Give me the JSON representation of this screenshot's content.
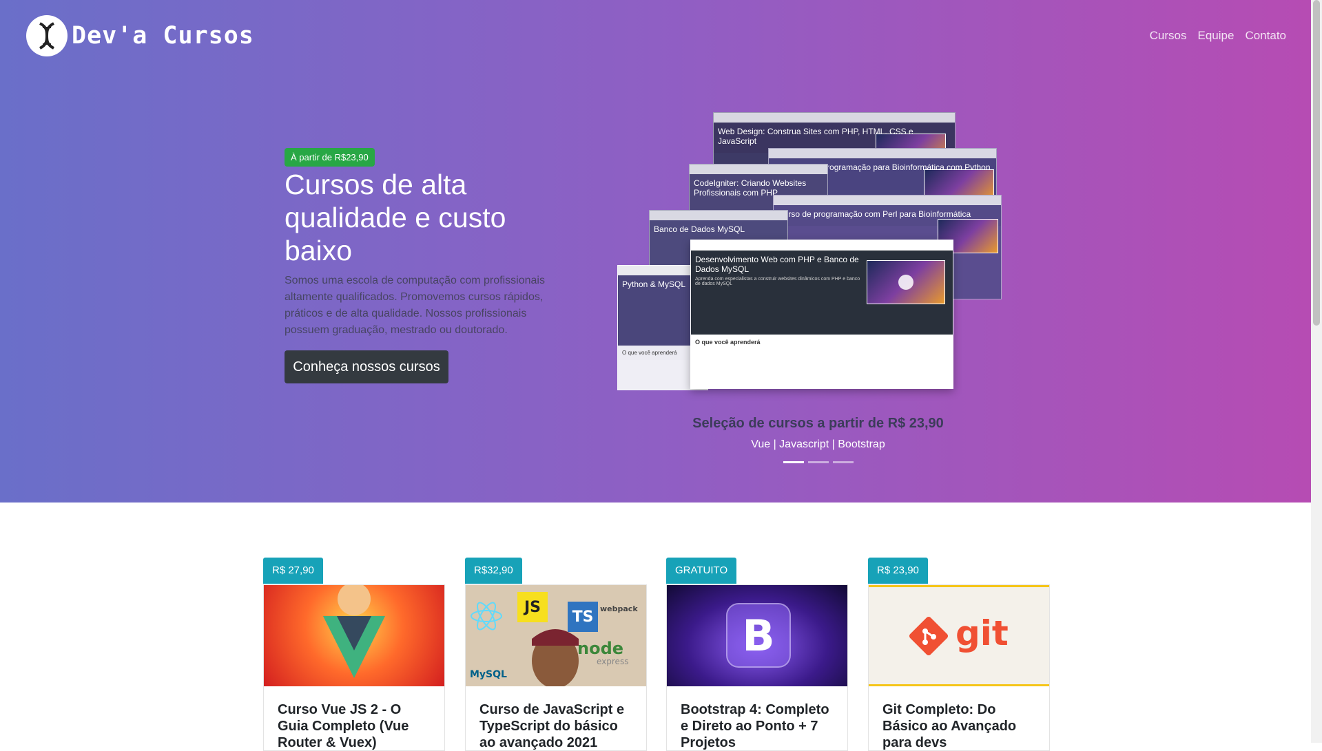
{
  "navbar": {
    "brand": "Dev'a Cursos",
    "links": [
      "Cursos",
      "Equipe",
      "Contato"
    ]
  },
  "hero": {
    "badge": "À partir de R$23,90",
    "title": "Cursos de alta qualidade e custo baixo",
    "description": "Somos uma escola de computação com profissionais altamente qualificados. Promovemos cursos rápidos, práticos e de alta qualidade. Nossos profissionais possuem graduação, mestrado ou doutorado.",
    "cta": "Conheça nossos cursos"
  },
  "carousel": {
    "screens": [
      "Web Design: Construa Sites com PHP, HTML, CSS e JavaScript",
      "Introdução à Programação para Bioinformática com Python",
      "CodeIgniter: Criando Websites Profissionais com PHP",
      "Curso de programação com Perl para Bioinformática",
      "Banco de Dados MySQL",
      "Python & MySQL",
      "Desenvolvimento Web com PHP e Banco de Dados MySQL"
    ],
    "caption_title": "Seleção de cursos a partir de R$ 23,90",
    "caption_sub": "Vue | Javascript | Bootstrap",
    "front_subtitle": "Aprenda com especialistas a construir websites dinâmicos com PHP e banco de dados MySQL",
    "learn_heading": "O que você aprenderá",
    "side_heading": "O que você aprenderá",
    "slide_count": 3,
    "active_slide": 1
  },
  "courses": [
    {
      "price": "R$ 27,90",
      "title": "Curso Vue JS 2 - O Guia Completo (Vue Router & Vuex)"
    },
    {
      "price": "R$32,90",
      "title": "Curso de JavaScript e TypeScript do básico ao avançado 2021"
    },
    {
      "price": "GRATUITO",
      "title": "Bootstrap 4: Completo e Direto ao Ponto + 7 Projetos"
    },
    {
      "price": "R$ 23,90",
      "title": "Git Completo: Do Básico ao Avançado para devs"
    }
  ],
  "images": {
    "js_labels": [
      "JS",
      "TS",
      "webpack",
      "node",
      "express",
      "MySQL"
    ],
    "bootstrap_letter": "B",
    "git_word": "git"
  },
  "colors": {
    "hero_gradient_start": "#6a6fc9",
    "hero_gradient_end": "#b64cb3",
    "badge_green": "#28a745",
    "price_teal": "#17a2b8",
    "button_dark": "#343a40"
  }
}
